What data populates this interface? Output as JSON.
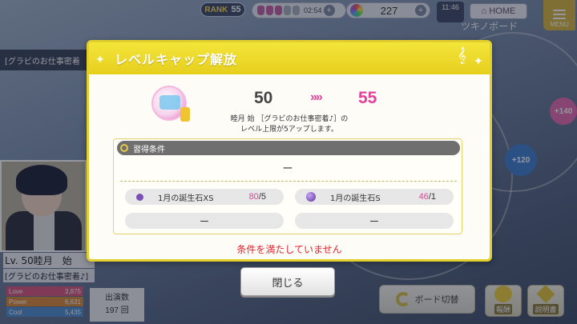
{
  "topbar": {
    "rank_label": "RANK",
    "rank_value": "55",
    "stamina_time": "02:54",
    "gem_count": "227",
    "clock": "11:46",
    "home_label": "HOME",
    "menu_label": "MENU",
    "board_title": "ツキノボード"
  },
  "background": {
    "banner_text": "[グラビのお仕事密着",
    "node_1": "+140",
    "node_2": "+120"
  },
  "character": {
    "level_name": "Lv. 50睦月　始",
    "skill_name": "[グラビのお仕事密着♪]",
    "stats": [
      {
        "label": "Love",
        "value": "3,875"
      },
      {
        "label": "Power",
        "value": "6,631"
      },
      {
        "label": "Cool",
        "value": "5,435"
      }
    ],
    "appear_label": "出演数",
    "appear_count": "197 回"
  },
  "bottom_bar": {
    "board_switch_label": "ボード切替",
    "btn_report_label": "報酬",
    "btn_badge_label": "説明書"
  },
  "modal": {
    "title": "レベルキャップ解放",
    "level_from": "50",
    "arrow": "»»",
    "level_to": "55",
    "desc_line1": "睦月 始 ［グラビのお仕事密着♪］の",
    "desc_line2": "レベル上限が5アップします。",
    "condition_header": "習得条件",
    "condition_main": "ー",
    "requirements": [
      {
        "name": "1月の誕生石XS",
        "have": "80",
        "need": "/5"
      },
      {
        "name": "1月の誕生石S",
        "have": "46",
        "need": "/1"
      }
    ],
    "empty_slot_1": "ー",
    "empty_slot_2": "ー",
    "warning": "条件を満たしていません"
  },
  "close_label": "閉じる",
  "colors": {
    "accent_yellow": "#e7cf1d",
    "accent_pink": "#e0449a",
    "warning_red": "#e4212e"
  }
}
